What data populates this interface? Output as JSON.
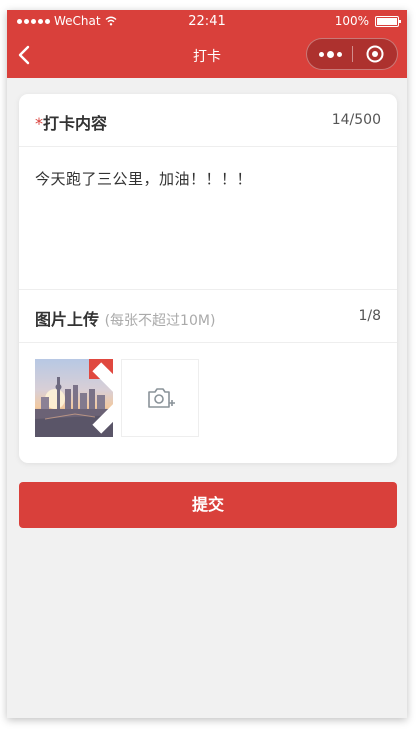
{
  "status_bar": {
    "carrier": "WeChat",
    "time": "22:41",
    "battery": "100%"
  },
  "nav": {
    "title": "打卡",
    "back_icon": "chevron-left-icon",
    "more_icon": "more-dots-icon",
    "close_icon": "target-circle-icon"
  },
  "form": {
    "content_required_mark": "*",
    "content_label": "打卡内容",
    "content_count": "14/500",
    "content_value": "今天跑了三公里，加油！！！！",
    "image_label": "图片上传",
    "image_hint": "(每张不超过10M)",
    "image_count": "1/8",
    "delete_icon": "close-icon",
    "add_icon": "camera-add-icon"
  },
  "submit_label": "提交",
  "colors": {
    "primary": "#d9403b",
    "background": "#f1f1f1",
    "card": "#ffffff"
  }
}
